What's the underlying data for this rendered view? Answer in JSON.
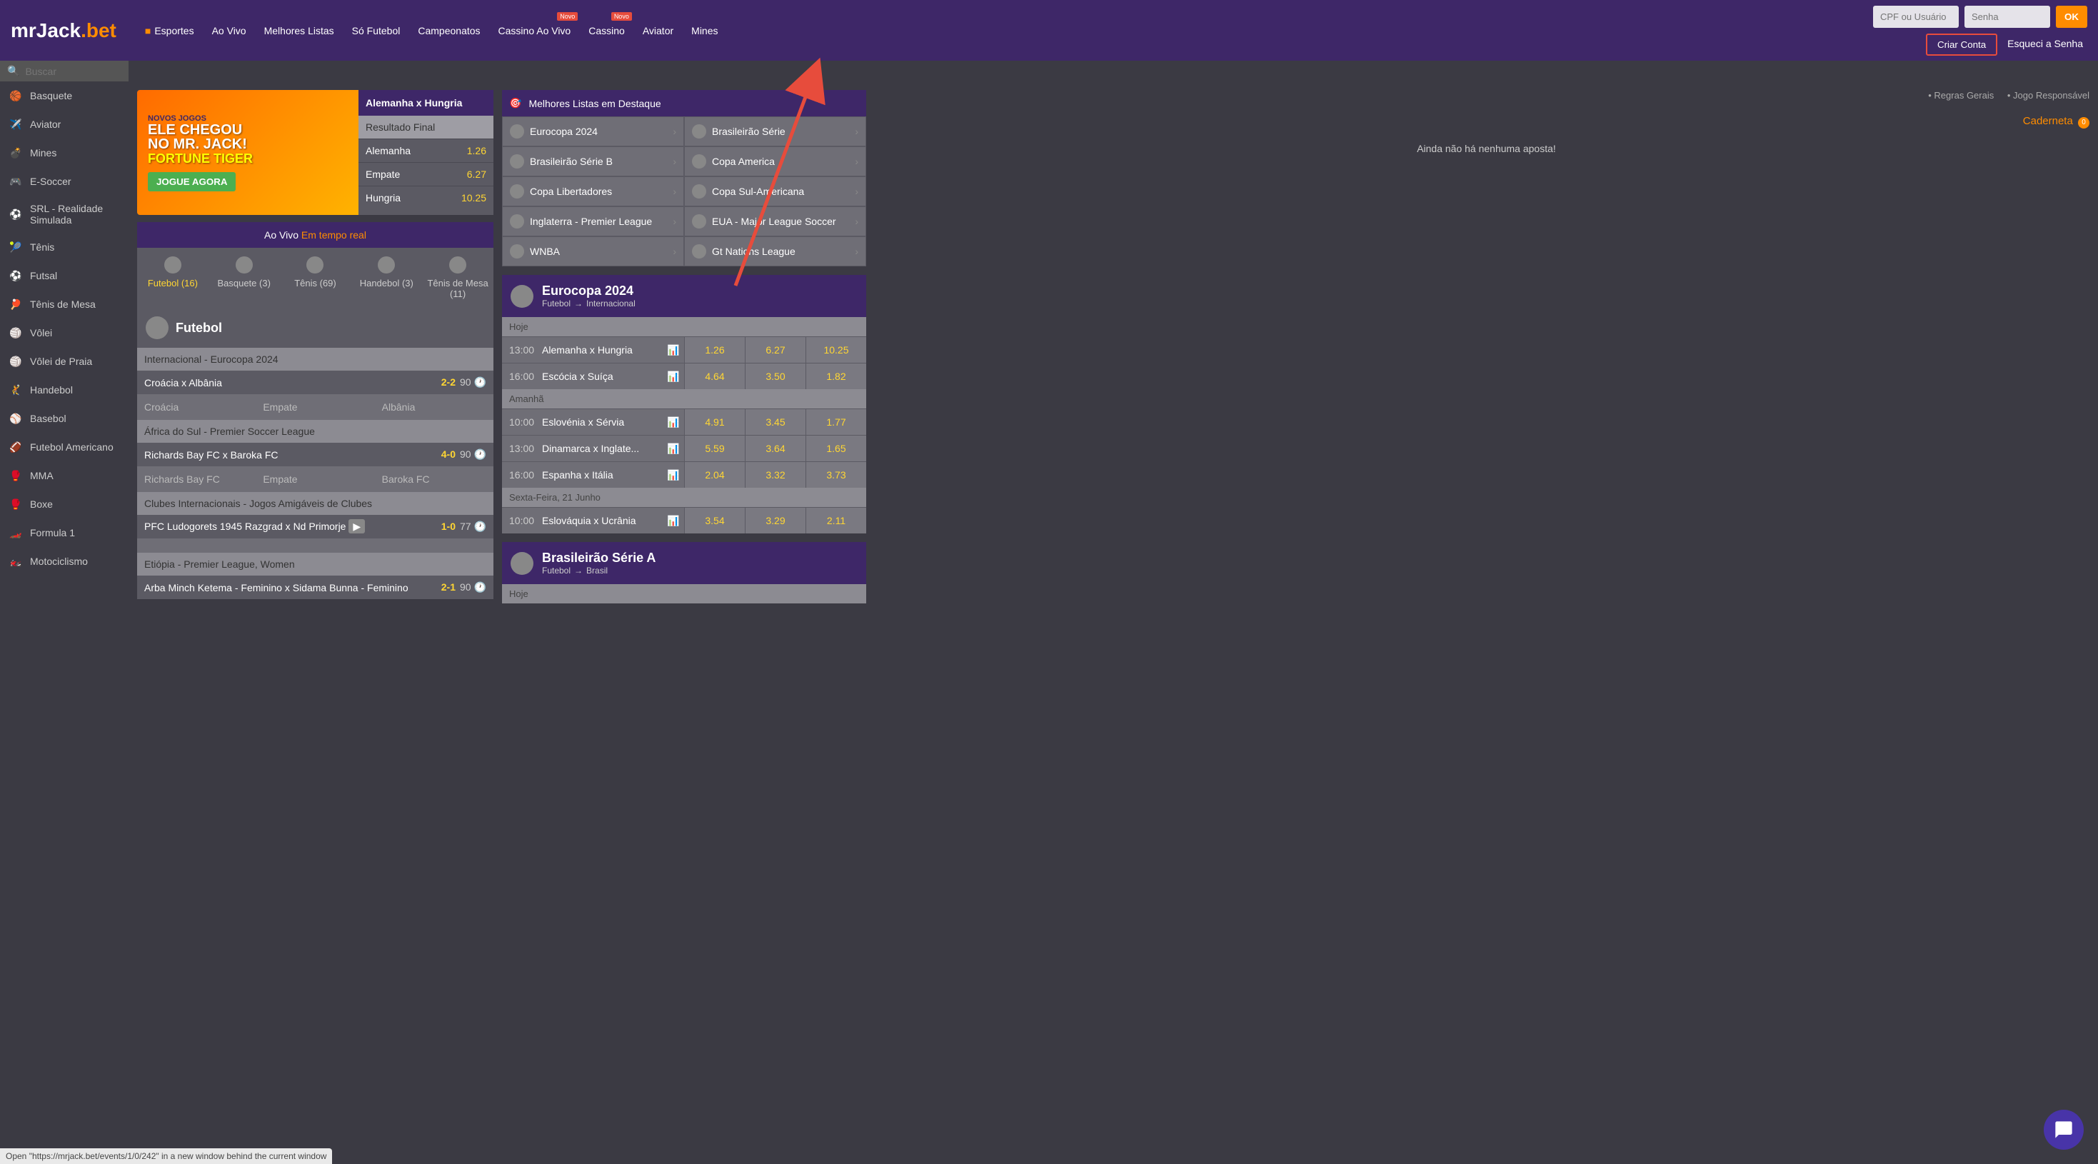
{
  "header": {
    "logo": {
      "mr": "mr",
      "jack": "Jack",
      "dot": ".",
      "bet": "bet"
    },
    "nav": [
      {
        "label": "Esportes",
        "active": true
      },
      {
        "label": "Ao Vivo"
      },
      {
        "label": "Melhores Listas"
      },
      {
        "label": "Só Futebol"
      },
      {
        "label": "Campeonatos"
      },
      {
        "label": "Cassino Ao Vivo",
        "badge": "Novo"
      },
      {
        "label": "Cassino",
        "badge": "Novo"
      },
      {
        "label": "Aviator"
      },
      {
        "label": "Mines"
      }
    ],
    "login": {
      "user_placeholder": "CPF ou Usuário",
      "pass_placeholder": "Senha",
      "ok": "OK",
      "criar": "Criar Conta",
      "esqueci": "Esqueci a Senha"
    }
  },
  "search": {
    "placeholder": "Buscar"
  },
  "sidebar": [
    {
      "label": "Basquete",
      "icon": "🏀"
    },
    {
      "label": "Aviator",
      "icon": "✈️"
    },
    {
      "label": "Mines",
      "icon": "💣"
    },
    {
      "label": "E-Soccer",
      "icon": "🎮"
    },
    {
      "label": "SRL - Realidade Simulada",
      "icon": "⚽"
    },
    {
      "label": "Tênis",
      "icon": "🎾"
    },
    {
      "label": "Futsal",
      "icon": "⚽"
    },
    {
      "label": "Tênis de Mesa",
      "icon": "🏓"
    },
    {
      "label": "Vôlei",
      "icon": "🏐"
    },
    {
      "label": "Vôlei de Praia",
      "icon": "🏐"
    },
    {
      "label": "Handebol",
      "icon": "🤾"
    },
    {
      "label": "Basebol",
      "icon": "⚾"
    },
    {
      "label": "Futebol Americano",
      "icon": "🏈"
    },
    {
      "label": "MMA",
      "icon": "🥊"
    },
    {
      "label": "Boxe",
      "icon": "🥊"
    },
    {
      "label": "Formula 1",
      "icon": "🏎️"
    },
    {
      "label": "Motociclismo",
      "icon": "🏍️"
    }
  ],
  "promo": {
    "banner": {
      "line1": "NOVOS JOGOS",
      "line2": "ELE CHEGOU",
      "line3": "NO MR. JACK!",
      "tiger": "FORTUNE TIGER",
      "cta": "JOGUE AGORA"
    },
    "match": {
      "title": "Alemanha x Hungria",
      "subtitle": "Resultado Final",
      "odds": [
        {
          "label": "Alemanha",
          "value": "1.26"
        },
        {
          "label": "Empate",
          "value": "6.27"
        },
        {
          "label": "Hungria",
          "value": "10.25"
        }
      ]
    }
  },
  "aovivo": {
    "title": "Ao Vivo",
    "subtitle": "Em tempo real",
    "tabs": [
      {
        "label": "Futebol (16)",
        "active": true
      },
      {
        "label": "Basquete (3)"
      },
      {
        "label": "Tênis (69)"
      },
      {
        "label": "Handebol (3)"
      },
      {
        "label": "Tênis de Mesa (11)"
      }
    ]
  },
  "futebol": {
    "title": "Futebol",
    "leagues": [
      {
        "name": "Internacional - Eurocopa 2024",
        "matches": [
          {
            "name": "Croácia x Albânia",
            "score": "2-2",
            "time": "90",
            "opts": [
              "Croácia",
              "Empate",
              "Albânia"
            ]
          }
        ]
      },
      {
        "name": "África do Sul - Premier Soccer League",
        "matches": [
          {
            "name": "Richards Bay FC x Baroka FC",
            "score": "4-0",
            "time": "90",
            "opts": [
              "Richards Bay FC",
              "Empate",
              "Baroka FC"
            ]
          }
        ]
      },
      {
        "name": "Clubes Internacionais - Jogos Amigáveis de Clubes",
        "matches": [
          {
            "name": "PFC Ludogorets 1945 Razgrad x Nd Primorje",
            "score": "1-0",
            "time": "77",
            "video": true
          }
        ]
      },
      {
        "name": "Etiópia - Premier League, Women",
        "matches": [
          {
            "name": "Arba Minch Ketema - Feminino x Sidama Bunna - Feminino",
            "score": "2-1",
            "time": "90"
          }
        ]
      }
    ]
  },
  "featured": {
    "title": "Melhores Listas em Destaque",
    "items": [
      {
        "label": "Eurocopa 2024"
      },
      {
        "label": "Brasileirão Série"
      },
      {
        "label": "Brasileirão Série B"
      },
      {
        "label": "Copa America"
      },
      {
        "label": "Copa Libertadores"
      },
      {
        "label": "Copa Sul-Americana"
      },
      {
        "label": "Inglaterra - Premier League"
      },
      {
        "label": "EUA - Major League Soccer"
      },
      {
        "label": "WNBA"
      },
      {
        "label": "Gt Nations League"
      }
    ]
  },
  "eurocopa": {
    "title": "Eurocopa 2024",
    "sport": "Futebol",
    "region": "Internacional",
    "days": [
      {
        "label": "Hoje",
        "events": [
          {
            "time": "13:00",
            "name": "Alemanha x Hungria",
            "odds": [
              "1.26",
              "6.27",
              "10.25"
            ]
          },
          {
            "time": "16:00",
            "name": "Escócia x Suíça",
            "odds": [
              "4.64",
              "3.50",
              "1.82"
            ]
          }
        ]
      },
      {
        "label": "Amanhã",
        "events": [
          {
            "time": "10:00",
            "name": "Eslovénia x Sérvia",
            "odds": [
              "4.91",
              "3.45",
              "1.77"
            ]
          },
          {
            "time": "13:00",
            "name": "Dinamarca x Inglate...",
            "odds": [
              "5.59",
              "3.64",
              "1.65"
            ]
          },
          {
            "time": "16:00",
            "name": "Espanha x Itália",
            "odds": [
              "2.04",
              "3.32",
              "3.73"
            ]
          }
        ]
      },
      {
        "label": "Sexta-Feira, 21 Junho",
        "events": [
          {
            "time": "10:00",
            "name": "Eslováquia x Ucrânia",
            "odds": [
              "3.54",
              "3.29",
              "2.11"
            ]
          }
        ]
      }
    ]
  },
  "brasileirao": {
    "title": "Brasileirão Série A",
    "sport": "Futebol",
    "region": "Brasil",
    "day": "Hoje"
  },
  "rightbar": {
    "rules": "Regras Gerais",
    "responsible": "Jogo Responsável",
    "caderneta": "Caderneta",
    "caderneta_count": "0",
    "no_bets": "Ainda não há nenhuma aposta!"
  },
  "status_bar": "Open \"https://mrjack.bet/events/1/0/242\" in a new window behind the current window"
}
